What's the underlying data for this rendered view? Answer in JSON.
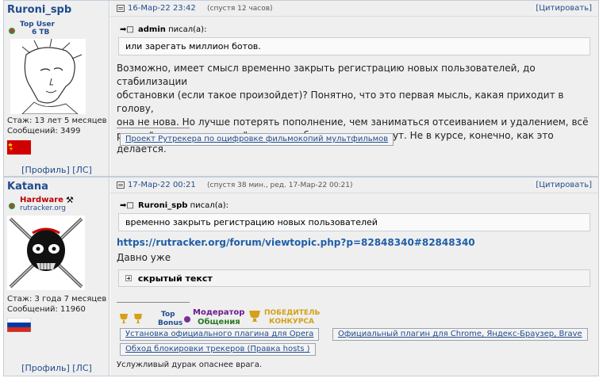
{
  "posts": [
    {
      "author": {
        "nick": "Ruroni_spb",
        "rank_line1": "Top User",
        "rank_line2": "6 TB",
        "tenure": "Стаж: 13 лет 5 месяцев",
        "messages": "Сообщений: 3499",
        "profile_label": "[Профиль]",
        "pm_label": "[ЛС]"
      },
      "date": "16-Мар-22 23:42",
      "ago": "(спустя 12 часов)",
      "quote_button": "[Цитировать]",
      "quote_author": "admin",
      "quote_wrote": "писал(а):",
      "quote_text": "или зарегать миллион ботов.",
      "text_lines": [
        "Возможно, имеет смысл временно закрыть регистрацию новых пользователей, до стабилизации",
        "обстановки (если такое произойдет)? Понятно, что это первая мысль, какая приходит в голову,",
        "она не нова. Но лучше потерять пополнение, чем заниматься отсеиванием и удалением, всё",
        "равно \"под горячую руку\" не только боты попасть могут. Не в курсе, конечно, как это делается."
      ],
      "signature_link": "Проект Рутрекера по оцифровке фильмокопий мультфильмов"
    },
    {
      "author": {
        "nick": "Katana",
        "rank_line1": "Hardware",
        "rank_line2": "rutracker.org",
        "tenure": "Стаж: 3 года 7 месяцев",
        "messages": "Сообщений: 11960",
        "profile_label": "[Профиль]",
        "pm_label": "[ЛС]"
      },
      "date": "17-Мар-22 00:21",
      "ago": "(спустя 38 мин., ред. 17-Мар-22 00:21)",
      "quote_button": "[Цитировать]",
      "quote_author": "Ruroni_spb",
      "quote_wrote": "писал(а):",
      "quote_text": "временно закрыть регистрацию новых пользователей",
      "link": "https://rutracker.org/forum/viewtopic.php?p=82848340#82848340",
      "after_link": "Давно уже",
      "hidden_label": "скрытый текст",
      "badges": {
        "top_bonus_1": "Top",
        "top_bonus_2": "Bonus",
        "moderator_1": "Модератор",
        "moderator_2": "Общения",
        "winner_1": "ПОБЕДИТЕЛЬ",
        "winner_2": "КОНКУРСА"
      },
      "signature_buttons": [
        "Установка официального плагина для Opera",
        "Официальный плагин для Chrome, Яндекс-Браузер, Brave",
        "Обход блокировки трекеров (Правка hosts )"
      ],
      "signature_text": "Услужливый дурак опаснее врага."
    }
  ],
  "colors": {
    "link": "#1f4b8d",
    "panel_bg": "#efefef",
    "border": "#c4cdd8"
  }
}
